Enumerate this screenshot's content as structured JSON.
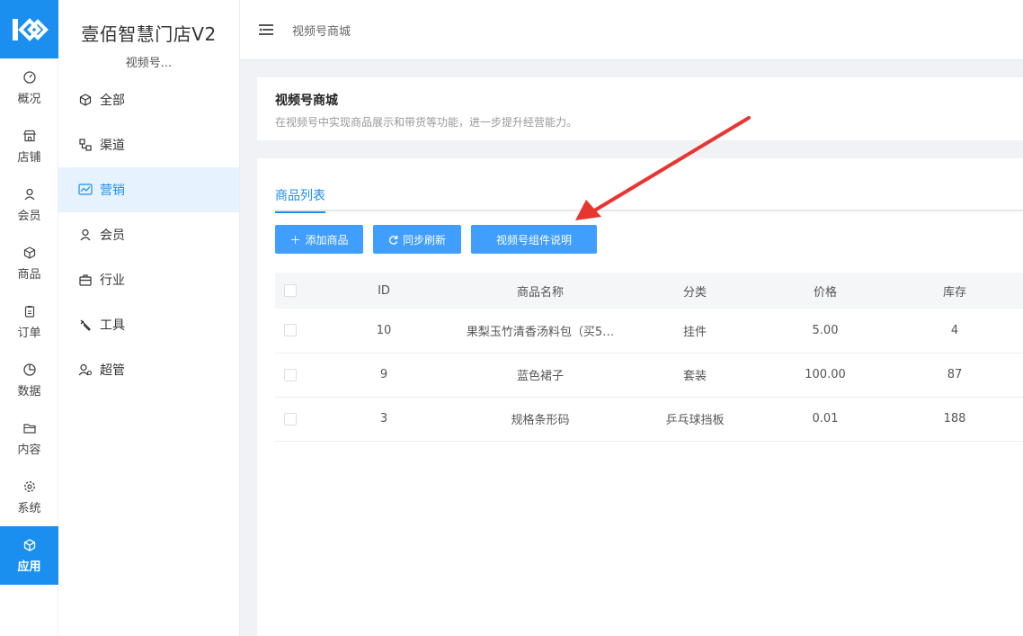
{
  "rail": {
    "items": [
      {
        "label": "概况",
        "icon": "dashboard-icon"
      },
      {
        "label": "店铺",
        "icon": "store-icon"
      },
      {
        "label": "会员",
        "icon": "user-icon"
      },
      {
        "label": "商品",
        "icon": "box-icon"
      },
      {
        "label": "订单",
        "icon": "clipboard-icon"
      },
      {
        "label": "数据",
        "icon": "pie-icon"
      },
      {
        "label": "内容",
        "icon": "folder-icon"
      },
      {
        "label": "系统",
        "icon": "gear-icon"
      },
      {
        "label": "应用",
        "icon": "cube-icon",
        "active": true
      }
    ]
  },
  "sidebar": {
    "brand": "壹佰智慧门店V2",
    "store": "视频号...",
    "items": [
      {
        "label": "全部"
      },
      {
        "label": "渠道"
      },
      {
        "label": "营销",
        "active": true
      },
      {
        "label": "会员"
      },
      {
        "label": "行业"
      },
      {
        "label": "工具"
      },
      {
        "label": "超管"
      }
    ]
  },
  "topbar": {
    "breadcrumb": "视频号商城"
  },
  "intro": {
    "title": "视频号商城",
    "desc": "在视频号中实现商品展示和带货等功能，进一步提升经营能力。"
  },
  "tabs": {
    "active": "商品列表"
  },
  "buttons": {
    "add": "添加商品",
    "sync": "同步刷新",
    "doc": "视频号组件说明"
  },
  "table": {
    "headers": [
      "ID",
      "商品名称",
      "分类",
      "价格",
      "库存"
    ],
    "rows": [
      [
        "10",
        "果梨玉竹清香汤料包（买5…",
        "挂件",
        "5.00",
        "4"
      ],
      [
        "9",
        "蓝色裙子",
        "套装",
        "100.00",
        "87"
      ],
      [
        "3",
        "规格条形码",
        "乒乓球挡板",
        "0.01",
        "188"
      ]
    ]
  },
  "colors": {
    "accent": "#1a8ff0",
    "button": "#409eff",
    "annotation": "#e8352f"
  }
}
